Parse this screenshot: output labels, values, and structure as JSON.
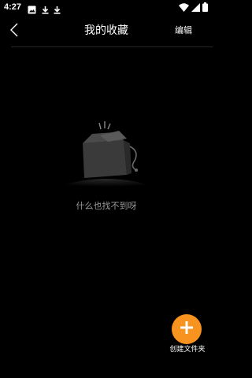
{
  "status_bar": {
    "time": "4:27",
    "left_icons": [
      "image-icon",
      "download-icon",
      "download-icon"
    ],
    "right_icons": [
      "wifi-icon",
      "signal-icon",
      "battery-icon"
    ]
  },
  "header": {
    "title": "我的收藏",
    "edit_label": "编辑"
  },
  "empty_state": {
    "message": "什么也找不到呀",
    "illustration": "empty-box-icon"
  },
  "fab": {
    "label": "创建文件夹",
    "icon": "plus-icon",
    "color": "#f7931e"
  },
  "colors": {
    "background": "#000000",
    "text_primary": "#ffffff",
    "text_secondary": "#9a9a9a",
    "accent": "#f7931e"
  }
}
